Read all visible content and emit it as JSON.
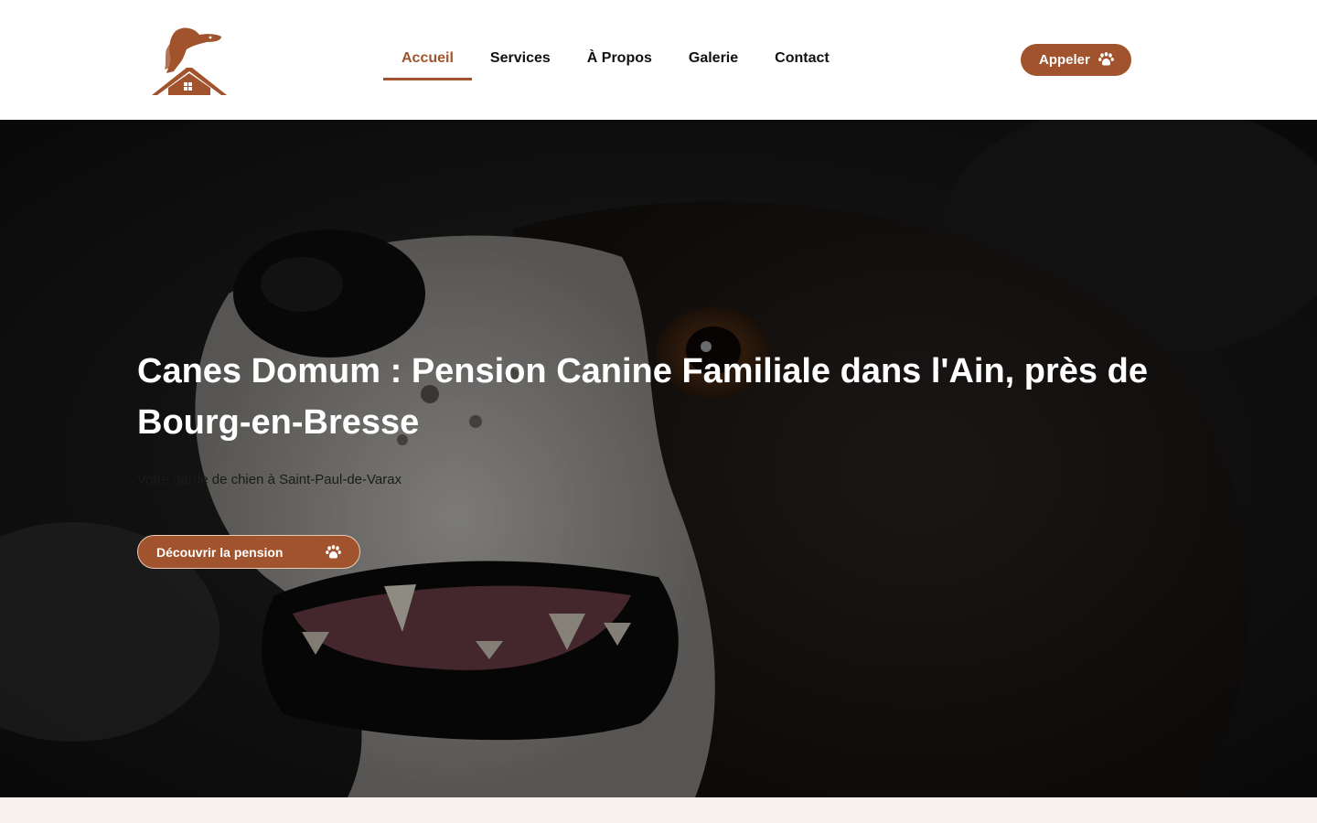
{
  "header": {
    "logo_icon": "dog-house-logo-icon",
    "nav": [
      {
        "label": "Accueil",
        "active": true
      },
      {
        "label": "Services",
        "active": false
      },
      {
        "label": "À Propos",
        "active": false
      },
      {
        "label": "Galerie",
        "active": false
      },
      {
        "label": "Contact",
        "active": false
      }
    ],
    "call_button": {
      "label": "Appeler",
      "icon": "paw-icon"
    }
  },
  "hero": {
    "background_icon": "dog-photo",
    "title": "Canes Domum : Pension Canine Familiale dans l'Ain, près de Bourg-en-Bresse",
    "subtitle": "Votre garde de chien à Saint-Paul-de-Varax",
    "cta": {
      "label": "Découvrir la pension",
      "icon": "paw-icon"
    }
  },
  "colors": {
    "accent": "#a0532c",
    "strip": "#f8f2ec"
  }
}
